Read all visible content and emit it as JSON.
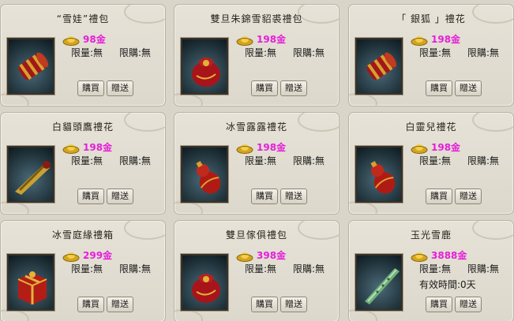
{
  "currency_label": "金",
  "buy_label": "購買",
  "gift_label": "贈送",
  "limit_qty_label": "限量:無",
  "limit_buy_label": "限購:無",
  "items": [
    {
      "name": "“雪娃”禮包",
      "price": "98金",
      "image": "firecracker-bundle",
      "extra": ""
    },
    {
      "name": "雙旦朱錦雪貂裘禮包",
      "price": "198金",
      "image": "red-gift-pouch",
      "extra": ""
    },
    {
      "name": "「 銀狐 」禮花",
      "price": "198金",
      "image": "firecracker-bundle",
      "extra": ""
    },
    {
      "name": "白貓頭鷹禮花",
      "price": "198金",
      "image": "golden-horn-firework",
      "extra": ""
    },
    {
      "name": "冰雪露露禮花",
      "price": "198金",
      "image": "red-gourd-firework",
      "extra": ""
    },
    {
      "name": "白靈兒禮花",
      "price": "198金",
      "image": "red-gourd-firework",
      "extra": ""
    },
    {
      "name": "冰雪庭緣禮箱",
      "price": "299金",
      "image": "red-gift-box",
      "extra": ""
    },
    {
      "name": "雙旦傢俱禮包",
      "price": "398金",
      "image": "red-gift-pouch",
      "extra": ""
    },
    {
      "name": "玉光雪鹿",
      "price": "3888金",
      "image": "jade-flute",
      "extra": "有效時間:0天"
    }
  ]
}
